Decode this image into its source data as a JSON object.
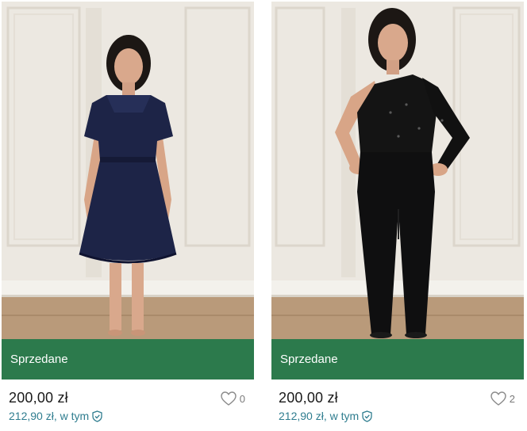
{
  "items": [
    {
      "status": "Sprzedane",
      "price": "200,00 zł",
      "price_with_fee": "212,90 zł, w tym",
      "favourites": "0",
      "photo_desc_icon": "photo-navy-lace-dress"
    },
    {
      "status": "Sprzedane",
      "price": "200,00 zł",
      "price_with_fee": "212,90 zł, w tym",
      "favourites": "2",
      "photo_desc_icon": "photo-black-one-shoulder-jumpsuit"
    }
  ],
  "colors": {
    "sold_bar": "#2c7a4c",
    "fee_text": "#2f7d8f",
    "wall": "#ece8e1",
    "floor": "#b99a7a"
  }
}
